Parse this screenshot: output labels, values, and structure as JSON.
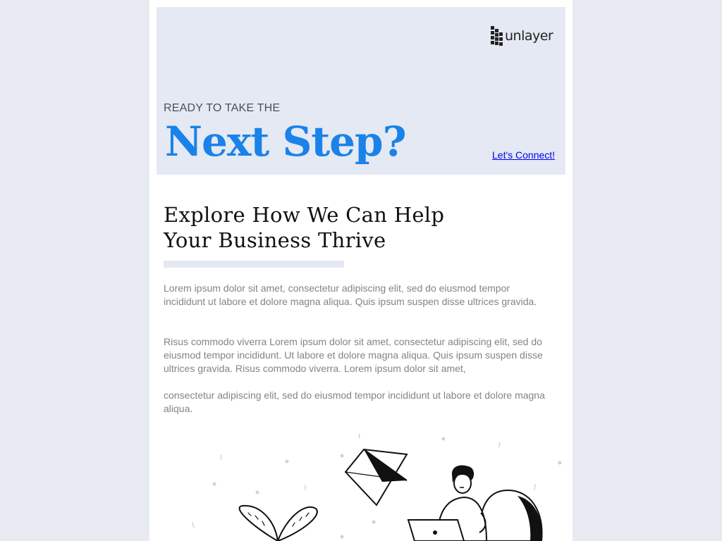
{
  "header": {
    "logo_text": "unlayer",
    "logo_icon": "unlayer-logo-icon",
    "kicker": "READY TO TAKE THE",
    "headline": "Next Step?",
    "cta_link": "Let's Connect!"
  },
  "content": {
    "title_line1": "Explore How We Can Help",
    "title_line2": "Your Business Thrive",
    "paragraphs": [
      "Lorem ipsum dolor sit amet, consectetur adipiscing elit, sed do eiusmod tempor incididunt ut labore et dolore magna aliqua. Quis ipsum suspen disse ultrices gravida.",
      "Risus commodo viverra Lorem ipsum dolor sit amet, consectetur adipiscing elit, sed do eiusmod tempor incididunt. Ut labore et dolore magna aliqua. Quis ipsum suspen disse ultrices gravida. Risus commodo viverra. Lorem ipsum dolor sit amet,",
      "consectetur adipiscing elit, sed do eiusmod tempor incididunt ut labore et dolore magna aliqua."
    ]
  },
  "illustration": {
    "icon": "person-with-laptop-illustration"
  },
  "colors": {
    "page_background": "#e7eaf0",
    "hero_background": "#e4e9f3",
    "headline_blue": "#1a82e8",
    "link_blue": "#0000ee",
    "body_text": "#828488"
  }
}
